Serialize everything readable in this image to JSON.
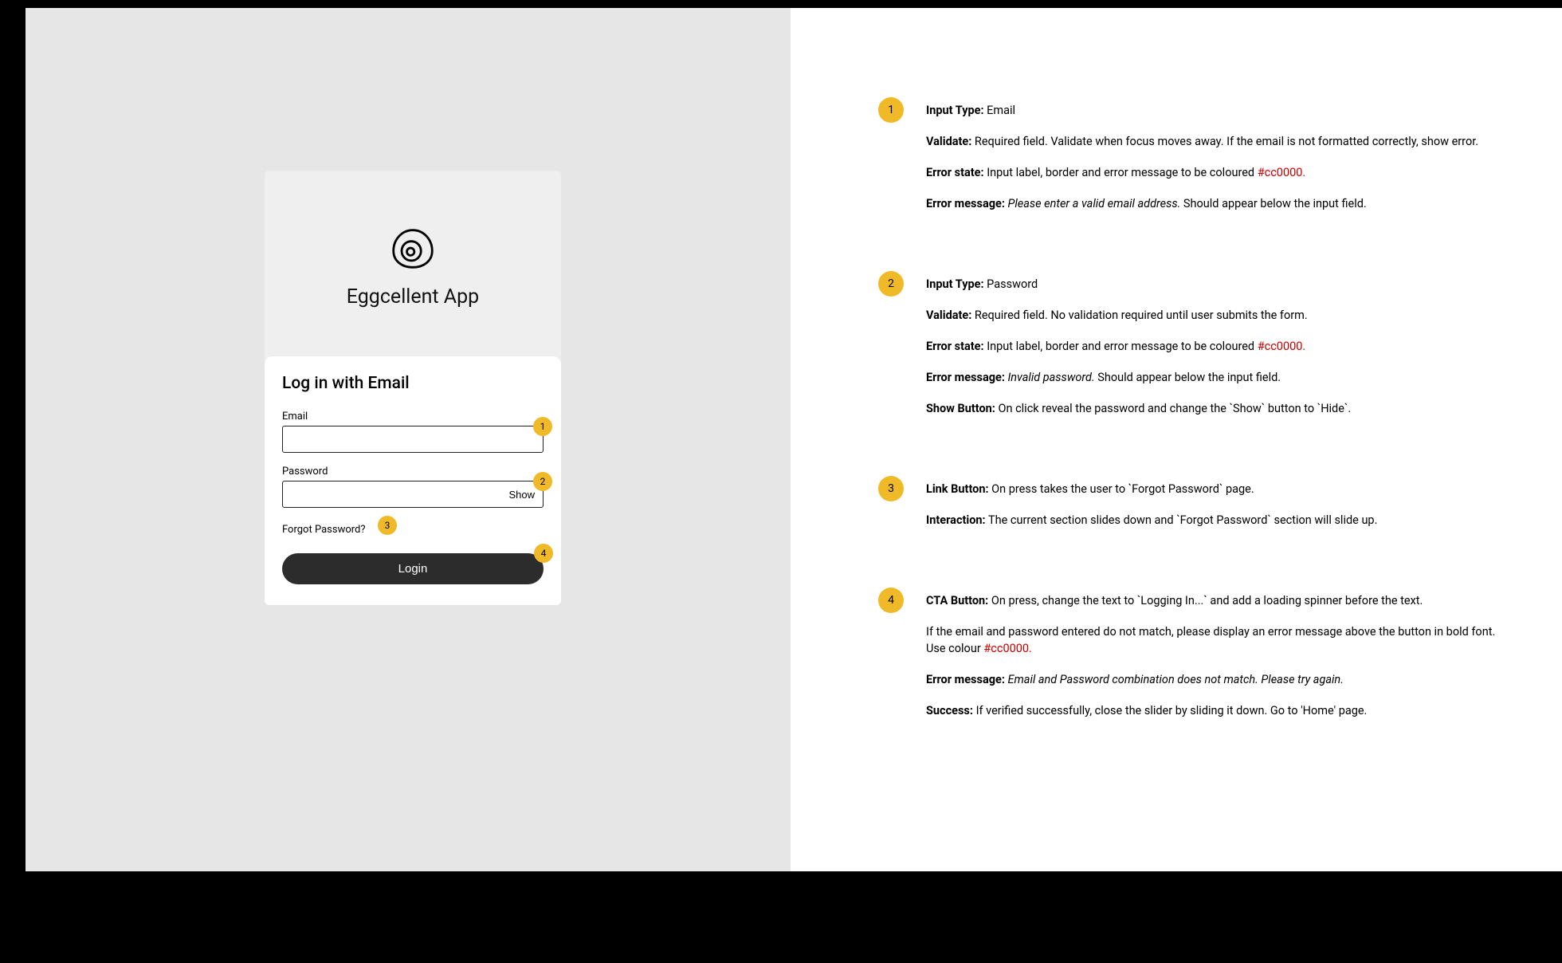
{
  "colors": {
    "error": "#cc0000",
    "marker_bg": "#f0b927"
  },
  "mockup": {
    "app_name": "Eggcellent App",
    "login_title": "Log in with Email",
    "email_label": "Email",
    "password_label": "Password",
    "show_label": "Show",
    "forgot_label": "Forgot Password?",
    "login_button": "Login",
    "markers": {
      "m1": "1",
      "m2": "2",
      "m3": "3",
      "m4": "4"
    }
  },
  "annotations": [
    {
      "num": "1",
      "lines": [
        {
          "label": "Input Type:",
          "text": " Email"
        },
        {
          "label": "Validate:",
          "text": " Required field. Validate when focus moves away. If the email is not formatted correctly, show error."
        },
        {
          "label": "Error state:",
          "text": " Input label, border and error message to be coloured ",
          "code": "#cc0000."
        },
        {
          "label": "Error message:",
          "italic": " Please enter a valid email address.",
          "text2": " Should appear below the input field."
        }
      ]
    },
    {
      "num": "2",
      "lines": [
        {
          "label": "Input Type:",
          "text": " Password"
        },
        {
          "label": "Validate:",
          "text": " Required field. No validation required until user submits the form."
        },
        {
          "label": "Error state:",
          "text": " Input label, border and error message to be coloured ",
          "code": "#cc0000."
        },
        {
          "label": "Error message:",
          "italic": " Invalid password.",
          "text2": " Should appear below the input field."
        },
        {
          "label": "Show Button:",
          "text": " On click reveal the password and change the `Show` button to `Hide`."
        }
      ]
    },
    {
      "num": "3",
      "lines": [
        {
          "label": "Link Button:",
          "text": " On press takes the user to `Forgot Password` page."
        },
        {
          "label": "Interaction:",
          "text": " The current section slides down and `Forgot Password` section will slide up."
        }
      ]
    },
    {
      "num": "4",
      "lines": [
        {
          "label": "CTA Button:",
          "text": " On press, change the text to `Logging In...` and add a loading spinner before the text."
        },
        {
          "text": "If the email and password entered do not match, please display an error message above the button in bold font. Use colour ",
          "code": "#cc0000."
        },
        {
          "label": "Error message:",
          "italic": " Email and Password combination does not match. Please try again."
        },
        {
          "label": "Success:",
          "text": " If verified successfully, close the slider by sliding it down. Go to 'Home' page."
        }
      ]
    }
  ]
}
